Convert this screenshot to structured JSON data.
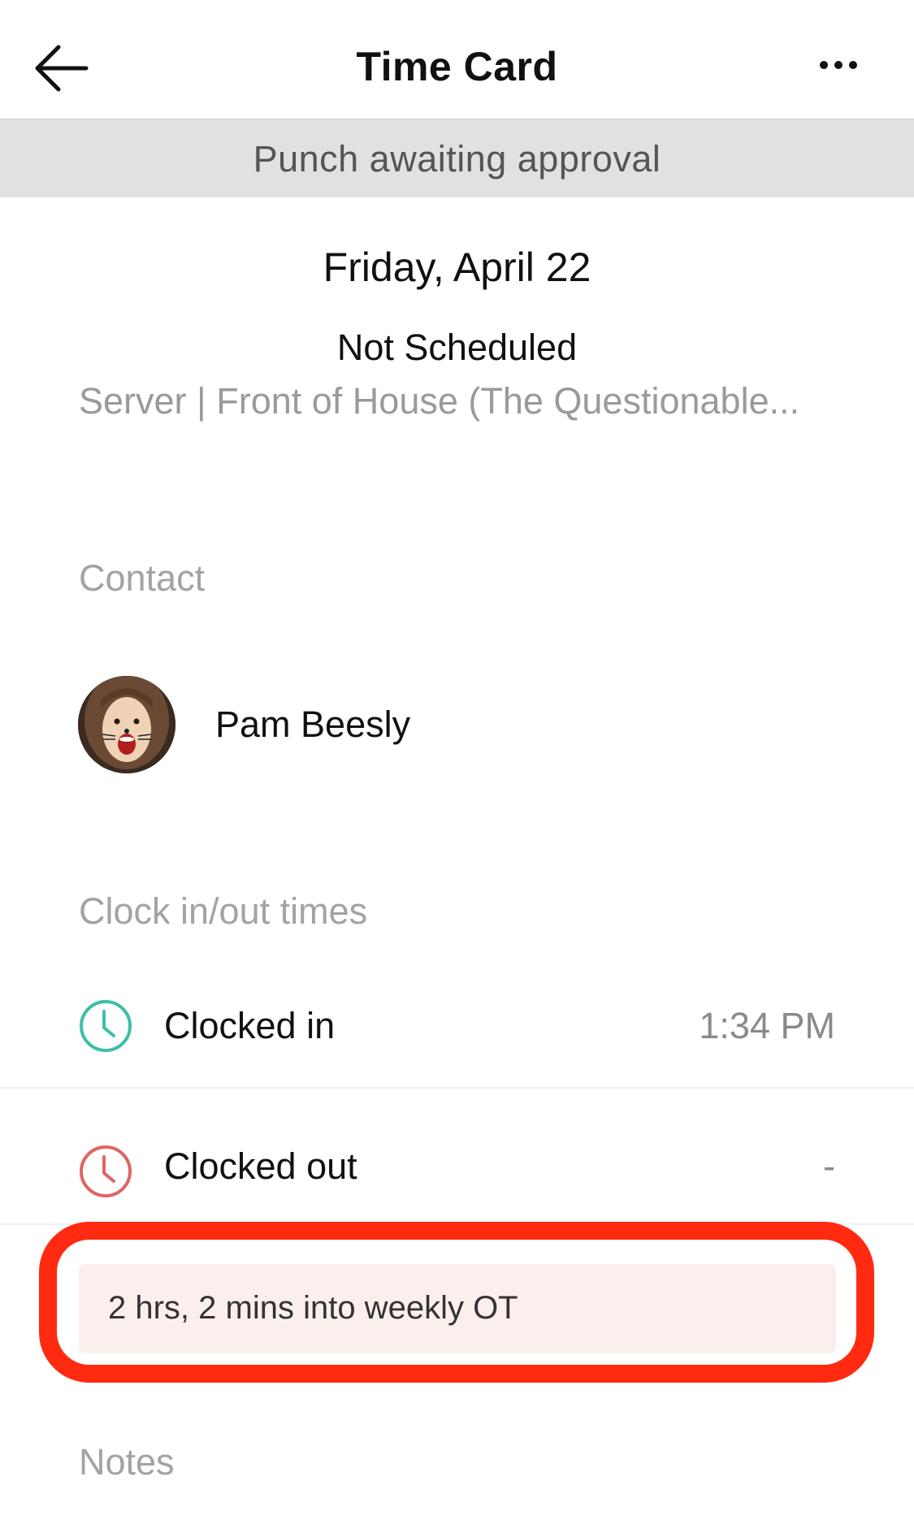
{
  "header": {
    "title": "Time Card",
    "back_icon": "arrow-left-icon",
    "more_icon": "more-horizontal-icon"
  },
  "banner": {
    "text": "Punch awaiting approval"
  },
  "shift": {
    "date": "Friday, April 22",
    "schedule_status": "Not Scheduled",
    "position": "Server | Front of House (The Questionable..."
  },
  "contact": {
    "label": "Contact",
    "name": "Pam Beesly",
    "avatar_icon": "avatar-photo"
  },
  "clock": {
    "label": "Clock in/out times",
    "rows": [
      {
        "label": "Clocked in",
        "time": "1:34 PM",
        "icon": "clock-icon",
        "color": "#3cbfa7"
      },
      {
        "label": "Clocked out",
        "time": "-",
        "icon": "clock-icon",
        "color": "#e06464"
      }
    ]
  },
  "overtime": {
    "text": "2 hrs, 2 mins into weekly OT",
    "highlight_color": "#ff2a10"
  },
  "notes": {
    "label": "Notes"
  }
}
